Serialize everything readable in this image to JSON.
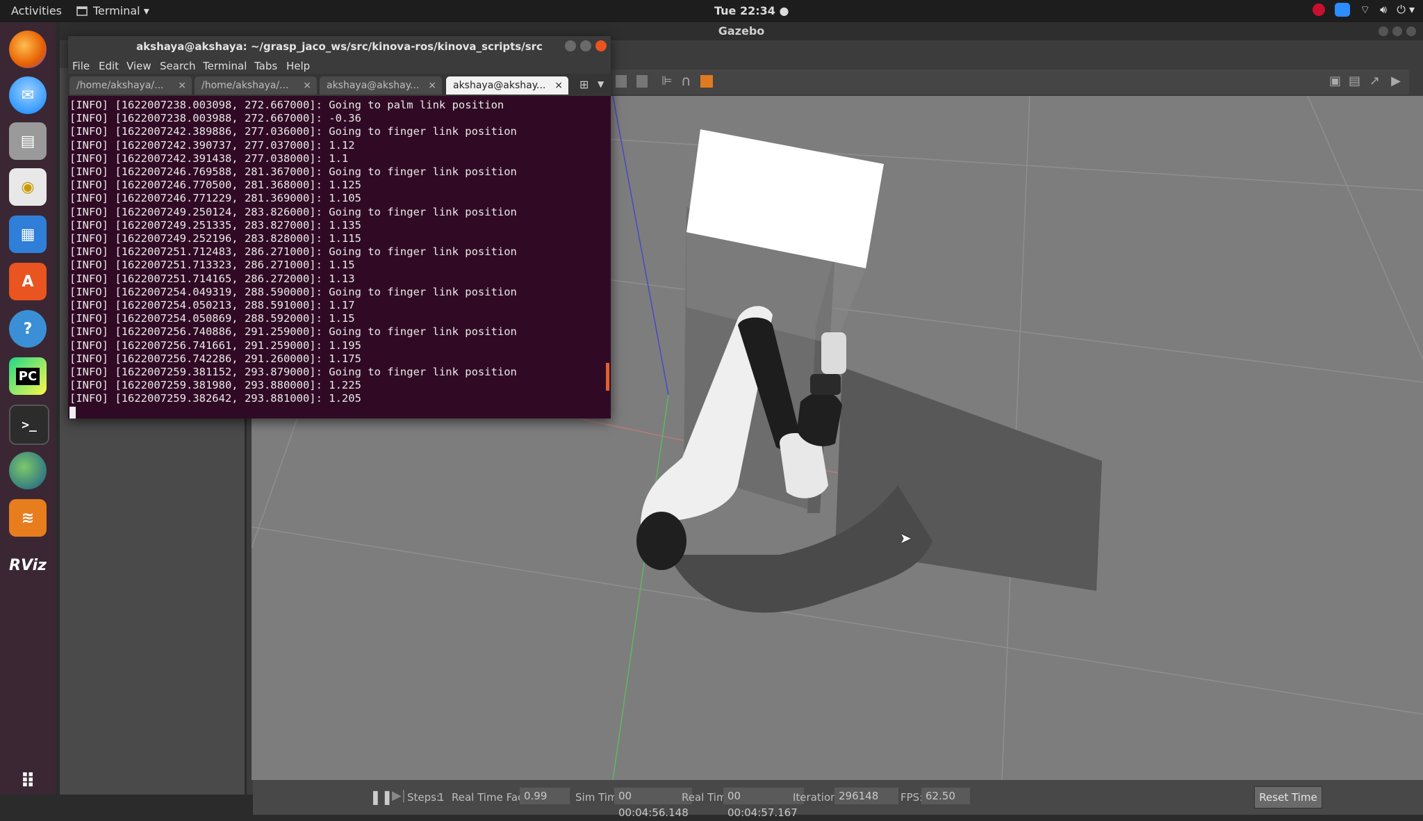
{
  "topbar": {
    "activities": "Activities",
    "app_menu": "Terminal ▾",
    "clock": "Tue 22:34 ●"
  },
  "dock": {
    "pycharm_text": "PC",
    "rviz_text": "RViz"
  },
  "gazebo": {
    "title": "Gazebo",
    "status": {
      "steps_label": "Steps:",
      "steps_value": "1",
      "rtf_label": "Real Time Factor:",
      "rtf_value": "0.99",
      "sim_time_label": "Sim Time:",
      "sim_time_value": "00 00:04:56.148",
      "real_time_label": "Real Time:",
      "real_time_value": "00 00:04:57.167",
      "iterations_label": "Iterations:",
      "iterations_value": "296148",
      "fps_label": "FPS:",
      "fps_value": "62.50",
      "reset_label": "Reset Time"
    }
  },
  "terminal": {
    "title": "akshaya@akshaya: ~/grasp_jaco_ws/src/kinova-ros/kinova_scripts/src",
    "menu": [
      "File",
      "Edit",
      "View",
      "Search",
      "Terminal",
      "Tabs",
      "Help"
    ],
    "tabs": [
      {
        "label": "/home/akshaya/..."
      },
      {
        "label": "/home/akshaya/..."
      },
      {
        "label": "akshaya@akshay..."
      },
      {
        "label": "akshaya@akshay..."
      }
    ],
    "lines": [
      "[INFO] [1622007238.003098, 272.667000]: Going to palm link position",
      "[INFO] [1622007238.003988, 272.667000]: -0.36",
      "[INFO] [1622007242.389886, 277.036000]: Going to finger link position",
      "[INFO] [1622007242.390737, 277.037000]: 1.12",
      "[INFO] [1622007242.391438, 277.038000]: 1.1",
      "[INFO] [1622007246.769588, 281.367000]: Going to finger link position",
      "[INFO] [1622007246.770500, 281.368000]: 1.125",
      "[INFO] [1622007246.771229, 281.369000]: 1.105",
      "[INFO] [1622007249.250124, 283.826000]: Going to finger link position",
      "[INFO] [1622007249.251335, 283.827000]: 1.135",
      "[INFO] [1622007249.252196, 283.828000]: 1.115",
      "[INFO] [1622007251.712483, 286.271000]: Going to finger link position",
      "[INFO] [1622007251.713323, 286.271000]: 1.15",
      "[INFO] [1622007251.714165, 286.272000]: 1.13",
      "[INFO] [1622007254.049319, 288.590000]: Going to finger link position",
      "[INFO] [1622007254.050213, 288.591000]: 1.17",
      "[INFO] [1622007254.050869, 288.592000]: 1.15",
      "[INFO] [1622007256.740886, 291.259000]: Going to finger link position",
      "[INFO] [1622007256.741661, 291.259000]: 1.195",
      "[INFO] [1622007256.742286, 291.260000]: 1.175",
      "[INFO] [1622007259.381152, 293.879000]: Going to finger link position",
      "[INFO] [1622007259.381980, 293.880000]: 1.225",
      "[INFO] [1622007259.382642, 293.881000]: 1.205"
    ]
  }
}
